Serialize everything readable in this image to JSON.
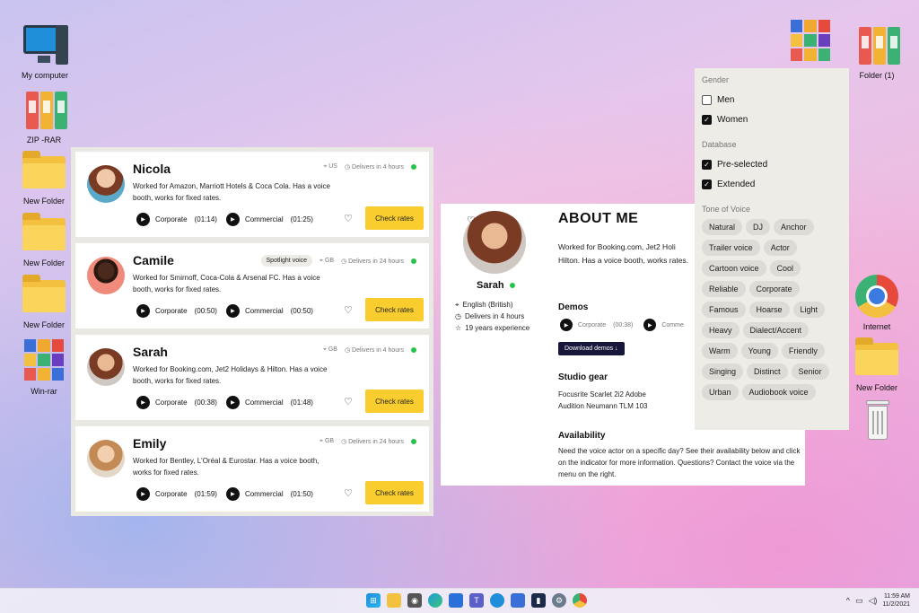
{
  "desktop": {
    "left_icons": [
      {
        "label": "My computer",
        "icon": "monitor-icon"
      },
      {
        "label": "ZIP -RAR",
        "icon": "binders-icon"
      },
      {
        "label": "New Folder",
        "icon": "folder-icon"
      },
      {
        "label": "New Folder",
        "icon": "folder-icon"
      },
      {
        "label": "New Folder",
        "icon": "folder-icon"
      },
      {
        "label": "Win-rar",
        "icon": "winrar-icon"
      }
    ],
    "right_icons": [
      {
        "label": "",
        "icon": "winrar-icon"
      },
      {
        "label": "Folder (1)",
        "icon": "binders-icon"
      },
      {
        "label": "Internet",
        "icon": "chrome-icon"
      },
      {
        "label": "New Folder",
        "icon": "folder-icon"
      },
      {
        "label": "",
        "icon": "trash-icon"
      }
    ]
  },
  "voices": [
    {
      "name": "Nicola",
      "country": "US",
      "delivery": "Delivers in 4 hours",
      "badge": "",
      "desc": "Worked for Amazon, Marriott Hotels & Coca Cola. Has a voice booth, works for fixed rates.",
      "demo1": "Corporate",
      "dur1": "(01:14)",
      "demo2": "Commercial",
      "dur2": "(01:25)",
      "cta": "Check rates"
    },
    {
      "name": "Camile",
      "country": "GB",
      "delivery": "Delivers in 24 hours",
      "badge": "Spotlight voice",
      "desc": "Worked for Smirnoff, Coca-Cola & Arsenal FC. Has a voice booth, works for fixed rates.",
      "demo1": "Corporate",
      "dur1": "(00:50)",
      "demo2": "Commercial",
      "dur2": "(00:50)",
      "cta": "Check rates"
    },
    {
      "name": "Sarah",
      "country": "GB",
      "delivery": "Delivers in 4 hours",
      "badge": "",
      "desc": "Worked for Booking.com, Jet2 Holidays & Hilton. Has a voice booth, works for fixed rates.",
      "demo1": "Corporate",
      "dur1": "(00:38)",
      "demo2": "Commercial",
      "dur2": "(01:48)",
      "cta": "Check rates"
    },
    {
      "name": "Emily",
      "country": "GB",
      "delivery": "Delivers in 24 hours",
      "badge": "",
      "desc": "Worked for Bentley, L'Oréal & Eurostar. Has a voice booth, works for fixed rates.",
      "demo1": "Corporate",
      "dur1": "(01:59)",
      "demo2": "Commercial",
      "dur2": "(01:50)",
      "cta": "Check rates"
    }
  ],
  "profile": {
    "name": "Sarah",
    "language": "English (British)",
    "delivery": "Delivers in 4 hours",
    "experience": "19 years experience",
    "about_title": "ABOUT ME",
    "bio": "Worked for Booking.com, Jet2 Holi Hilton. Has a voice booth, works rates.",
    "demos_title": "Demos",
    "demo1": "Corporate",
    "dur1": "(00:38)",
    "demo2": "Comme",
    "download": "Download demos ↓",
    "gear_title": "Studio gear",
    "gear1": "Focusrite Scarlet 2i2 Adobe",
    "gear2": "Audition Neumann TLM 103",
    "avail_title": "Availability",
    "avail_text": "Need the voice actor on a specific day? See their availability below and click on the indicator for more information. Questions? Contact the voice via the menu on the right."
  },
  "filters": {
    "gender_title": "Gender",
    "gender": [
      {
        "label": "Men",
        "checked": false
      },
      {
        "label": "Women",
        "checked": true
      }
    ],
    "database_title": "Database",
    "database": [
      {
        "label": "Pre-selected",
        "checked": true
      },
      {
        "label": "Extended",
        "checked": true
      }
    ],
    "tone_title": "Tone of Voice",
    "tones": [
      "Natural",
      "DJ",
      "Anchor",
      "Trailer voice",
      "Actor",
      "Cartoon voice",
      "Cool",
      "Reliable",
      "Corporate",
      "Famous",
      "Hoarse",
      "Light",
      "Heavy",
      "Dialect/Accent",
      "Warm",
      "Young",
      "Friendly",
      "Singing",
      "Distinct",
      "Senior",
      "Urban",
      "Audiobook voice"
    ]
  },
  "taskbar": {
    "time": "11:59 AM",
    "date": "11/2/2021",
    "caret": "^"
  }
}
